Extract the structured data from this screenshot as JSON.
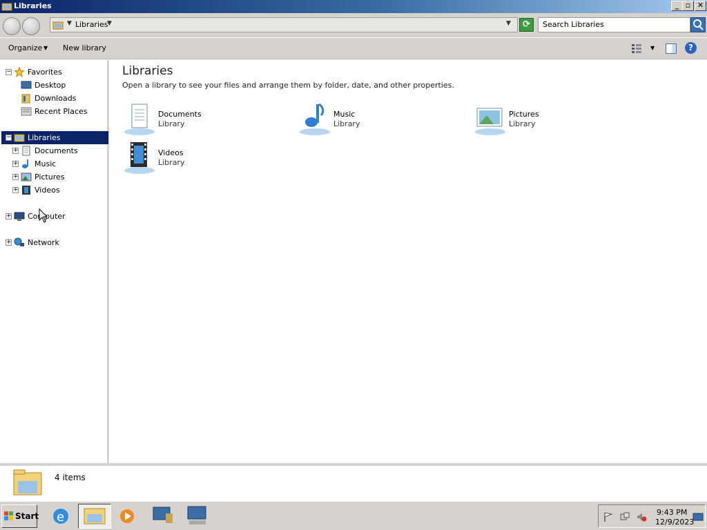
{
  "window": {
    "title": "Libraries"
  },
  "titlebar_buttons": {
    "minimize": "_",
    "maximize": "▫",
    "close": "✕"
  },
  "address": {
    "breadcrumb": "Libraries",
    "search_placeholder": "Search Libraries"
  },
  "commands": {
    "organize": "Organize",
    "new_library": "New library"
  },
  "help_label": "?",
  "nav": {
    "favorites": "Favorites",
    "favorites_items": [
      "Desktop",
      "Downloads",
      "Recent Places"
    ],
    "libraries": "Libraries",
    "libraries_items": [
      "Documents",
      "Music",
      "Pictures",
      "Videos"
    ],
    "computer": "Computer",
    "network": "Network"
  },
  "main": {
    "heading": "Libraries",
    "subheading": "Open a library to see your files and arrange them by folder, date, and other properties.",
    "libraries": [
      {
        "name": "Documents",
        "type": "Library",
        "icon": "documents-icon"
      },
      {
        "name": "Music",
        "type": "Library",
        "icon": "music-icon"
      },
      {
        "name": "Pictures",
        "type": "Library",
        "icon": "pictures-icon"
      },
      {
        "name": "Videos",
        "type": "Library",
        "icon": "videos-icon"
      }
    ]
  },
  "details": {
    "item_count": "4 items"
  },
  "taskbar": {
    "start": "Start",
    "time": "9:43 PM",
    "date": "12/9/2023"
  },
  "colors": {
    "titlebar": "#0a246a",
    "selection": "#0a246a",
    "chrome": "#d6d3ce"
  }
}
